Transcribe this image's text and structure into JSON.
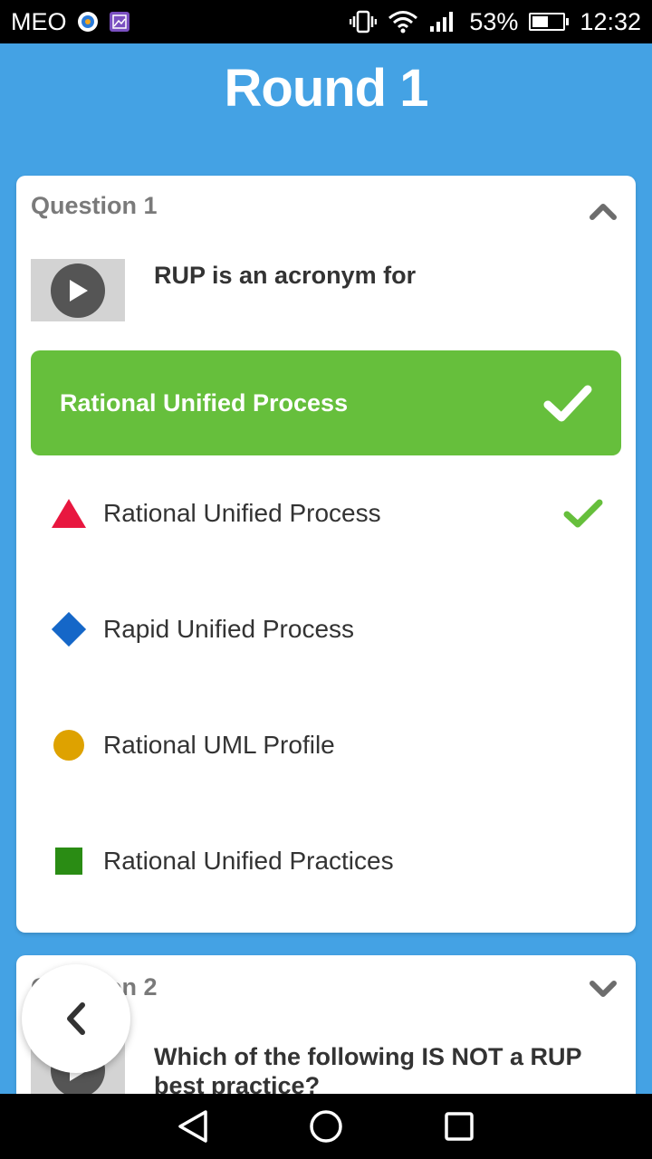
{
  "status_bar": {
    "carrier": "MEO",
    "battery_percent": "53%",
    "battery_level": 0.53,
    "time": "12:32"
  },
  "header": {
    "title": "Round 1"
  },
  "question_1": {
    "label": "Question 1",
    "text": "RUP is an acronym for",
    "correct_answer": "Rational Unified Process",
    "options": [
      {
        "shape": "triangle",
        "color": "#e8173f",
        "label": "Rational Unified Process",
        "correct": true
      },
      {
        "shape": "diamond",
        "color": "#1567c8",
        "label": "Rapid Unified Process",
        "correct": false
      },
      {
        "shape": "circle",
        "color": "#dea200",
        "label": "Rational UML Profile",
        "correct": false
      },
      {
        "shape": "square",
        "color": "#2a8c14",
        "label": "Rational Unified Practices",
        "correct": false
      }
    ]
  },
  "question_2": {
    "label": "Question 2",
    "text": "Which of the following IS NOT a RUP best practice?"
  },
  "colors": {
    "background": "#44a2e4",
    "correct_green": "#66bf3c",
    "label_gray": "#7a7a7a"
  }
}
